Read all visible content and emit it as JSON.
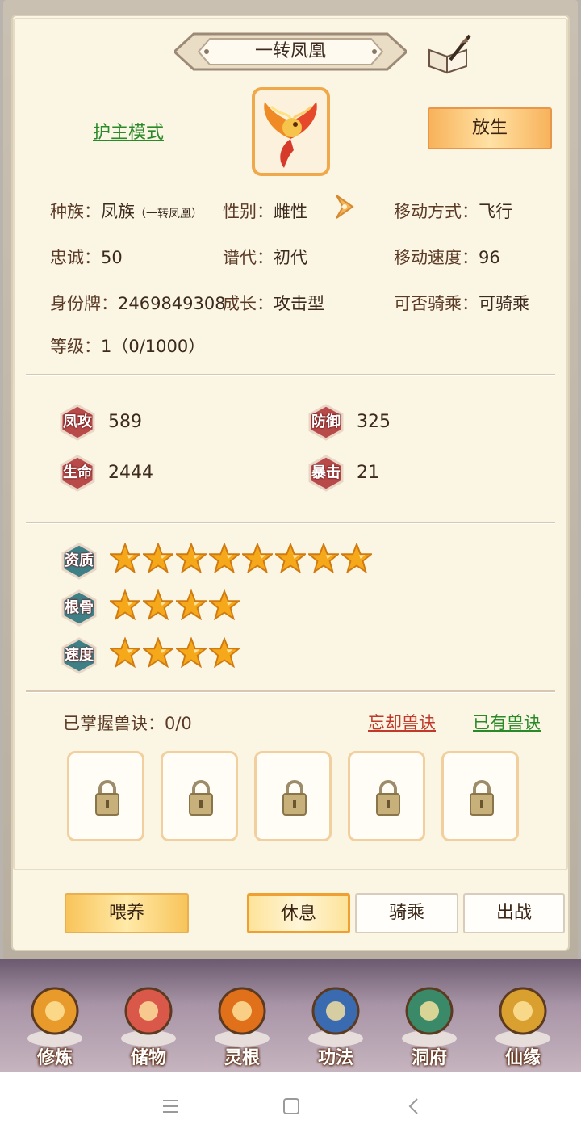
{
  "title": "一转凤凰",
  "guard_mode": "护主模式",
  "release_button": "放生",
  "info": {
    "race_label": "种族：",
    "race_value": "凤族",
    "race_note": "（一转凤凰）",
    "gender_label": "性别：",
    "gender_value": "雌性",
    "move_type_label": "移动方式：",
    "move_type_value": "飞行",
    "loyalty_label": "忠诚：",
    "loyalty_value": "50",
    "generation_label": "谱代：",
    "generation_value": "初代",
    "move_speed_label": "移动速度：",
    "move_speed_value": "96",
    "id_label": "身份牌：",
    "id_value": "2469849308",
    "growth_label": "成长：",
    "growth_value": "攻击型",
    "rideable_label": "可否骑乘：",
    "rideable_value": "可骑乘",
    "level_label": "等级：",
    "level_value": "1（0/1000）"
  },
  "stats": [
    {
      "label": "凤攻",
      "value": "589"
    },
    {
      "label": "防御",
      "value": "325"
    },
    {
      "label": "生命",
      "value": "2444"
    },
    {
      "label": "暴击",
      "value": "21"
    }
  ],
  "ratings": [
    {
      "label": "资质",
      "stars": 8
    },
    {
      "label": "根骨",
      "stars": 4
    },
    {
      "label": "速度",
      "stars": 4
    }
  ],
  "skills": {
    "mastered_label": "已掌握兽诀：0/0",
    "forget_link": "忘却兽诀",
    "owned_link": "已有兽诀",
    "locked_slots": 5
  },
  "actions": {
    "feed": "喂养",
    "rest": "休息",
    "ride": "骑乘",
    "battle": "出战"
  },
  "nav": [
    {
      "label": "修炼",
      "icon": "cultivation-monk-icon"
    },
    {
      "label": "储物",
      "icon": "storage-bag-icon"
    },
    {
      "label": "灵根",
      "icon": "spirit-root-icon"
    },
    {
      "label": "功法",
      "icon": "scripture-book-icon"
    },
    {
      "label": "洞府",
      "icon": "cave-palace-icon"
    },
    {
      "label": "仙缘",
      "icon": "gourd-icon"
    }
  ],
  "colors": {
    "panel_bg": "#fbf6e4",
    "link_green": "#2a8a2a",
    "link_red": "#c0392b",
    "badge_red": "#b84a4a",
    "badge_teal": "#3f7f86",
    "star_gold": "#f4a81a"
  }
}
